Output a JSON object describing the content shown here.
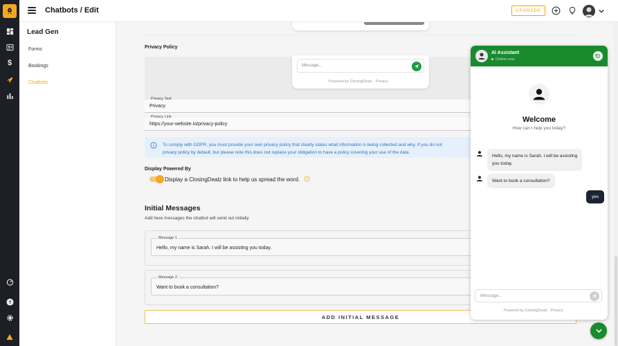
{
  "topbar": {
    "title": "Chatbots / Edit",
    "upgrade_label": "UPGRADE"
  },
  "rail": {
    "icons": [
      "rocket-logo-icon",
      "dashboard-icon",
      "contacts-icon",
      "dollar-icon",
      "rocket-icon",
      "bar-chart-icon",
      "speedometer-icon",
      "help-icon",
      "settings-icon",
      "warning-icon"
    ]
  },
  "sidemenu": {
    "heading": "Lead Gen",
    "items": [
      {
        "label": "Forms"
      },
      {
        "label": "Bookings"
      },
      {
        "label": "Chatbots"
      }
    ]
  },
  "privacy": {
    "heading": "Privacy Policy",
    "preview_placeholder": "Message...",
    "preview_powered": "Powered by ClosingDealz · Privacy",
    "privacy_text_label": "Privacy Text",
    "privacy_text_value": "Privacy",
    "privacy_link_label": "Privacy Link",
    "privacy_link_value": "https://your-website.io/privacy-policy",
    "info_line1": "To comply with GDPR, you must provide your own privacy policy that clearly states what information is being collected and why. If you do not",
    "info_line2": "privacy policy by default, but please note this does not replace your obligation to have a policy covering your use of the data."
  },
  "powered_by": {
    "heading": "Display Powered By",
    "toggle_label": "Display a ClosingDealz link to help us spread the word.",
    "enabled": true
  },
  "initial_messages": {
    "title": "Initial Messages",
    "subtitle": "Add here messages the chatbot will send out initially",
    "messages": [
      {
        "label": "Message 1",
        "value": "Hello, my name is Sarah. I will be assisting you today."
      },
      {
        "label": "Message 2",
        "value": "Want to book a consultation?"
      }
    ],
    "add_button": "ADD INITIAL MESSAGE"
  },
  "chat": {
    "name": "AI Assistant",
    "status": "Online now",
    "welcome": "Welcome",
    "welcome_sub": "How can I help you today?",
    "bot_messages": [
      {
        "line1": "Hello, my name is Sarah. I will be assisting",
        "line2": "you today."
      },
      {
        "line1": "Want to book a consultation?",
        "line2": ""
      }
    ],
    "user_message": "yes",
    "input_placeholder": "Message...",
    "powered": "Powered by ClosingDealz · Privacy",
    "accent": "#1a8a2f"
  },
  "colors": {
    "brand_orange": "#f5a623",
    "rail_bg": "#1c1f26",
    "info_text": "#2e74c0"
  }
}
